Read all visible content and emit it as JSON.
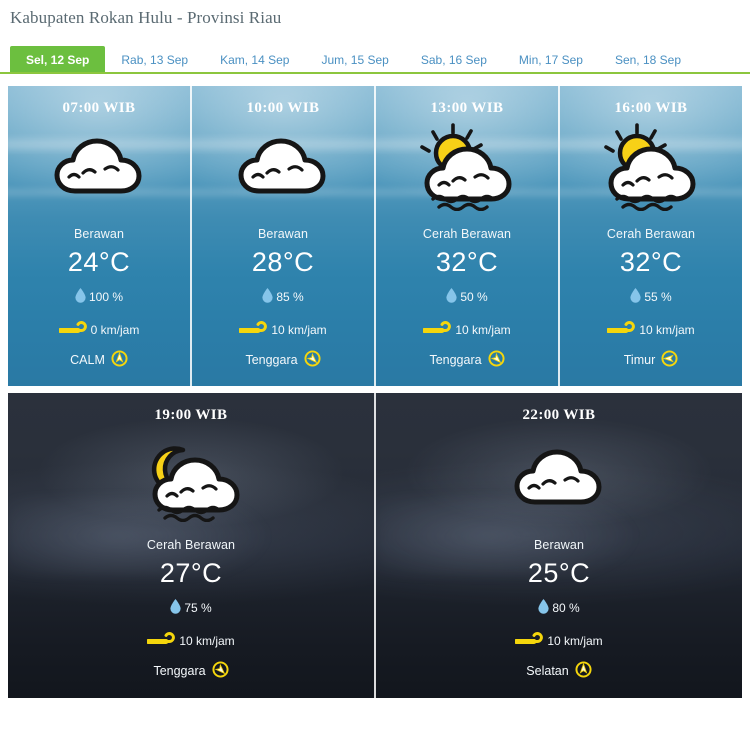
{
  "header": {
    "title": "Kabupaten Rokan Hulu - Provinsi Riau"
  },
  "tabs": [
    {
      "label": "Sel, 12 Sep",
      "active": true
    },
    {
      "label": "Rab, 13 Sep",
      "active": false
    },
    {
      "label": "Kam, 14 Sep",
      "active": false
    },
    {
      "label": "Jum, 15 Sep",
      "active": false
    },
    {
      "label": "Sab, 16 Sep",
      "active": false
    },
    {
      "label": "Min, 17 Sep",
      "active": false
    },
    {
      "label": "Sen, 18 Sep",
      "active": false
    }
  ],
  "colors": {
    "active_tab": "#6cbf3f",
    "tab_text": "#4a90c2",
    "tab_underline": "#8cc63e",
    "title_text": "#5a6a72",
    "wind_icon": "#f5d60c",
    "humidity_icon": "#86c5ea",
    "compass_ring": "#f5d60c"
  },
  "forecast": {
    "day_row": [
      {
        "hour": "07:00 WIB",
        "icon": "cloud-icon",
        "condition": "Berawan",
        "temperature": "24°C",
        "humidity": "100 %",
        "humidity_icon": "water-drop-icon",
        "wind_speed": "0 km/jam",
        "wind_icon": "wind-icon",
        "wind_direction": "CALM",
        "direction_icon": "compass-arrow-up-icon"
      },
      {
        "hour": "10:00 WIB",
        "icon": "cloud-icon",
        "condition": "Berawan",
        "temperature": "28°C",
        "humidity": "85 %",
        "humidity_icon": "water-drop-icon",
        "wind_speed": "10 km/jam",
        "wind_icon": "wind-icon",
        "wind_direction": "Tenggara",
        "direction_icon": "compass-arrow-southeast-icon"
      },
      {
        "hour": "13:00 WIB",
        "icon": "sun-behind-cloud-icon",
        "condition": "Cerah Berawan",
        "temperature": "32°C",
        "humidity": "50 %",
        "humidity_icon": "water-drop-icon",
        "wind_speed": "10 km/jam",
        "wind_icon": "wind-icon",
        "wind_direction": "Tenggara",
        "direction_icon": "compass-arrow-southeast-icon"
      },
      {
        "hour": "16:00 WIB",
        "icon": "sun-behind-cloud-icon",
        "condition": "Cerah Berawan",
        "temperature": "32°C",
        "humidity": "55 %",
        "humidity_icon": "water-drop-icon",
        "wind_speed": "10 km/jam",
        "wind_icon": "wind-icon",
        "wind_direction": "Timur",
        "direction_icon": "compass-arrow-west-icon"
      }
    ],
    "night_row": [
      {
        "hour": "19:00 WIB",
        "icon": "moon-behind-cloud-icon",
        "condition": "Cerah Berawan",
        "temperature": "27°C",
        "humidity": "75 %",
        "humidity_icon": "water-drop-icon",
        "wind_speed": "10 km/jam",
        "wind_icon": "wind-icon",
        "wind_direction": "Tenggara",
        "direction_icon": "compass-arrow-southeast-icon"
      },
      {
        "hour": "22:00 WIB",
        "icon": "cloud-icon",
        "condition": "Berawan",
        "temperature": "25°C",
        "humidity": "80 %",
        "humidity_icon": "water-drop-icon",
        "wind_speed": "10 km/jam",
        "wind_icon": "wind-icon",
        "wind_direction": "Selatan",
        "direction_icon": "compass-arrow-up-icon"
      }
    ]
  }
}
